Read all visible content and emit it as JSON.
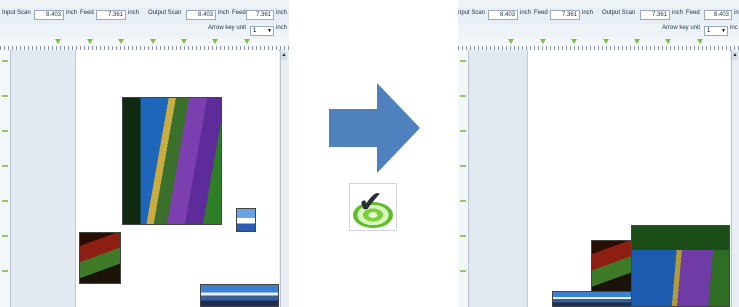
{
  "before": {
    "input_scan_label": "Input Scan",
    "input_scan_value": "8.403",
    "unit1": "inch",
    "feed1_label": "Feed",
    "feed1_value": "7.361",
    "unit2": "inch",
    "output_scan_label": "Output Scan",
    "output_scan_value": "8.403",
    "unit3": "inch",
    "feed2_label": "Feed",
    "feed2_value": "7.361",
    "unit4": "inch",
    "arrow_key_label": "Arrow key unit",
    "arrow_key_value": "1",
    "arrow_key_unit": "inch"
  },
  "after": {
    "input_scan_label": "nput Scan",
    "input_scan_value": "8.403",
    "unit1": "inch",
    "feed1_label": "Feed",
    "feed1_value": "7.361",
    "unit2": "inch",
    "output_scan_label": "Output Scan",
    "output_scan_value": "7.361",
    "unit3": "inch",
    "feed2_label": "Feed",
    "feed2_value": "8.403",
    "unit4": "inc",
    "arrow_key_label": "Arrow key unit",
    "arrow_key_value": "1",
    "arrow_key_unit": "inc"
  },
  "colors": {
    "arrow": "#4e81bd",
    "accent_green": "#7bc043",
    "panel": "#eef3f8"
  },
  "icons": {
    "transition": "arrow-right-icon",
    "app": "check-target-icon"
  }
}
